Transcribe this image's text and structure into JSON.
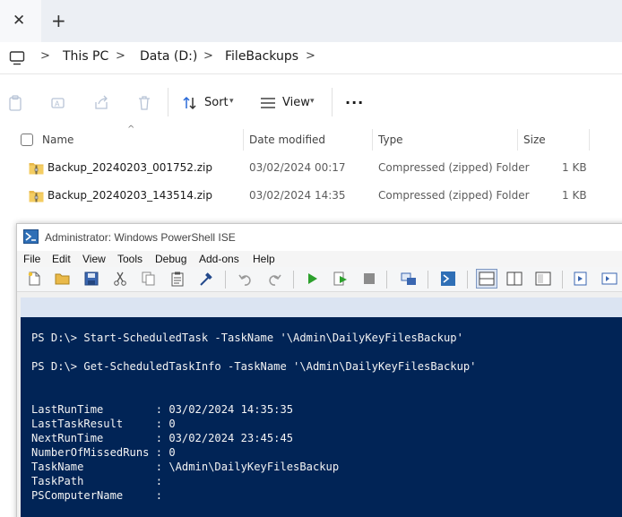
{
  "explorer": {
    "breadcrumb": [
      "This PC",
      "Data (D:)",
      "FileBackups"
    ],
    "toolbar": {
      "sort_label": "Sort",
      "view_label": "View",
      "more_label": "..."
    },
    "columns": [
      "Name",
      "Date modified",
      "Type",
      "Size"
    ],
    "files": [
      {
        "name": "Backup_20240203_001752.zip",
        "date": "03/02/2024 00:17",
        "type": "Compressed (zipped) Folder",
        "size": "1 KB"
      },
      {
        "name": "Backup_20240203_143514.zip",
        "date": "03/02/2024 14:35",
        "type": "Compressed (zipped) Folder",
        "size": "1 KB"
      }
    ]
  },
  "ise": {
    "title": "Administrator: Windows PowerShell ISE",
    "menu": [
      "File",
      "Edit",
      "View",
      "Tools",
      "Debug",
      "Add-ons",
      "Help"
    ],
    "console_lines": [
      "PS D:\\> Start-ScheduledTask -TaskName '\\Admin\\DailyKeyFilesBackup'",
      "PS D:\\> Get-ScheduledTaskInfo -TaskName '\\Admin\\DailyKeyFilesBackup'",
      "LastRunTime        : 03/02/2024 14:35:35",
      "LastTaskResult     : 0",
      "NextRunTime        : 03/02/2024 23:45:45",
      "NumberOfMissedRuns : 0",
      "TaskName           : \\Admin\\DailyKeyFilesBackup",
      "TaskPath           :",
      "PSComputerName     :"
    ]
  },
  "colors": {
    "console_bg": "#012456",
    "zip_folder": "#e8b84a",
    "accent_blue": "#2a6ad8"
  }
}
